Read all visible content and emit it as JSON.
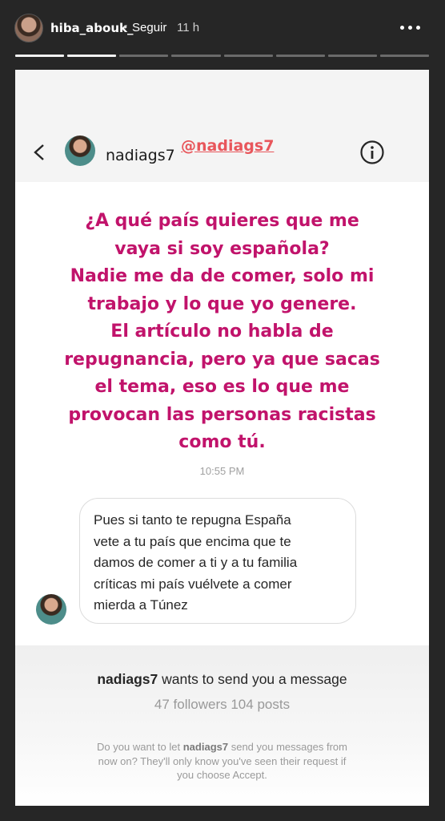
{
  "story": {
    "username": "hiba_abouk_",
    "separator": "•",
    "follow_label": "Seguir",
    "time": "11 h",
    "progress_total": 8,
    "progress_done": 2
  },
  "dm_header": {
    "username": "nadiags7",
    "mention": "@nadiags7"
  },
  "message_large_lines": [
    "¿A qué país quieres que me",
    "vaya si soy española?",
    "Nadie me da de comer, solo mi",
    "trabajo y lo que yo genere.",
    "El artículo no habla de",
    "repugnancia, pero ya que sacas",
    "el tema, eso es lo que me",
    "provocan las personas racistas",
    "como tú."
  ],
  "message_time": "10:55 PM",
  "incoming_message_lines": [
    "Pues si tanto te repugna España",
    "vete a tu país que encima que te",
    "damos de comer a ti y a tu familia",
    "críticas mi país vuélvete a comer",
    "mierda a Túnez"
  ],
  "request": {
    "username": "nadiags7",
    "title_suffix": "wants to send you a message",
    "stats": "47 followers 104 posts",
    "desc_prefix": "Do you want to let",
    "desc_username": "nadiags7",
    "desc_line1_suffix": "send you messages from",
    "desc_line2": "now on? They'll only know you've seen their request if",
    "desc_line3": "you choose Accept."
  },
  "colors": {
    "accent_text": "#c1136b",
    "mention": "#e8565b"
  }
}
